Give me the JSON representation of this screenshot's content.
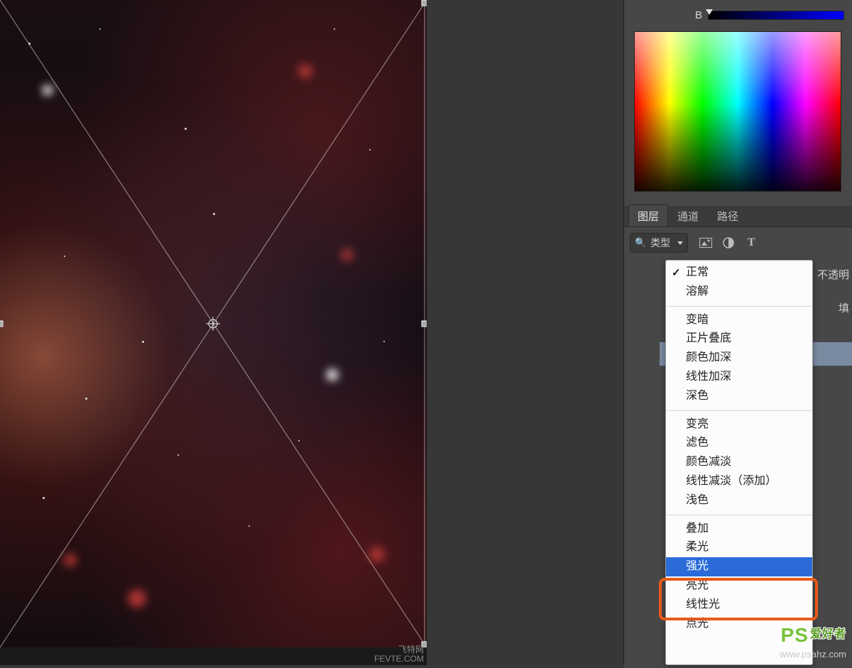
{
  "color_panel": {
    "channel_label": "B"
  },
  "panel_tabs": {
    "layers": "图层",
    "channels": "通道",
    "paths": "路径"
  },
  "filter": {
    "label": "类型",
    "search_icon": "search-icon",
    "chevron_icon": "chevron-down-icon",
    "image_icon": "image-icon",
    "adjust_icon": "adjust-icon",
    "text_icon": "text-icon"
  },
  "right_labels": {
    "opacity": "不透明",
    "fill": "填"
  },
  "blend_modes": {
    "normal": "正常",
    "dissolve": "溶解",
    "darken": "变暗",
    "multiply": "正片叠底",
    "color_burn": "颜色加深",
    "linear_burn": "线性加深",
    "darker_color": "深色",
    "lighten": "变亮",
    "screen": "滤色",
    "color_dodge": "颜色减淡",
    "linear_dodge": "线性减淡（添加）",
    "lighter_color": "浅色",
    "overlay": "叠加",
    "soft_light": "柔光",
    "hard_light": "强光",
    "vivid_light": "亮光",
    "linear_light": "线性光",
    "pin_light": "点光"
  },
  "blend_current": "正常",
  "blend_highlighted": "强光",
  "credit": {
    "line1": "飞特网",
    "line2": "FEVTE.COM"
  },
  "watermark": {
    "brand_a": "PS",
    "brand_b": "爱好者",
    "url": "www.psahz.com"
  },
  "icons": {
    "search": "🔍",
    "text": "T"
  }
}
